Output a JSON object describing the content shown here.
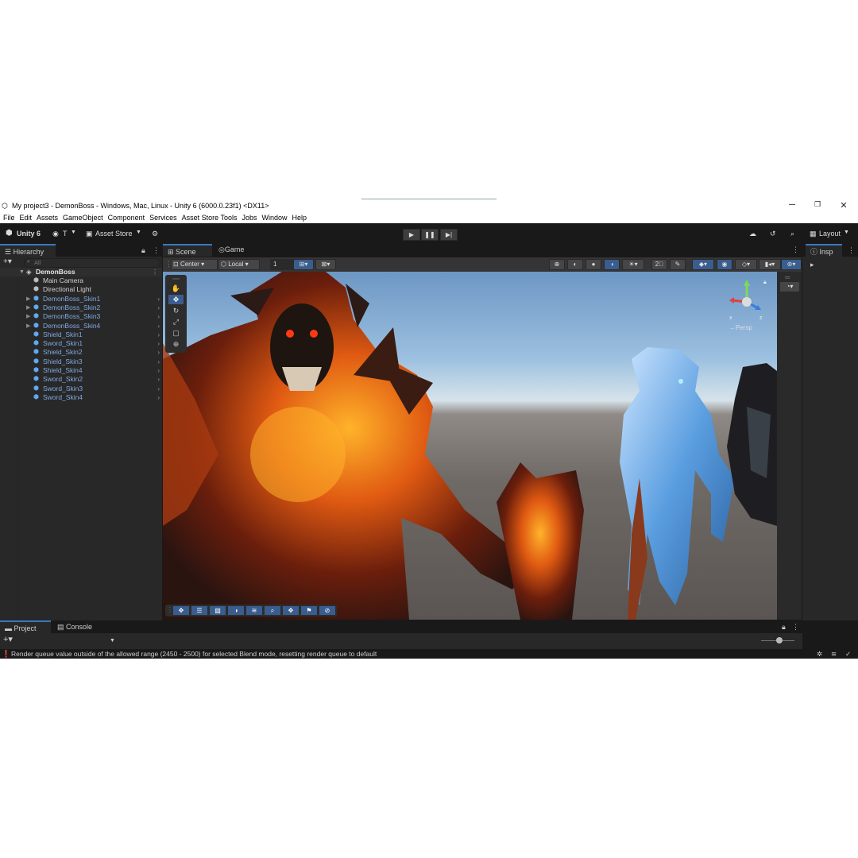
{
  "window": {
    "title": "My project3 - DemonBoss - Windows, Mac, Linux - Unity 6 (6000.0.23f1) <DX11>",
    "controls": [
      "─",
      "❐",
      "✕"
    ]
  },
  "menu": [
    "File",
    "Edit",
    "Assets",
    "GameObject",
    "Component",
    "Services",
    "Asset Store Tools",
    "Jobs",
    "Window",
    "Help"
  ],
  "toolbar": {
    "unity_label": "Unity 6",
    "account_label": "T",
    "asset_store_label": "Asset Store",
    "layout_label": "Layout"
  },
  "hierarchy": {
    "tab_label": "Hierarchy",
    "search_placeholder": "All",
    "root": "DemonBoss",
    "items": [
      {
        "label": "Main Camera",
        "prefab": false,
        "expandable": false
      },
      {
        "label": "Directional Light",
        "prefab": false,
        "expandable": false
      },
      {
        "label": "DemonBoss_Skin1",
        "prefab": true,
        "expandable": true
      },
      {
        "label": "DemonBoss_Skin2",
        "prefab": true,
        "expandable": true
      },
      {
        "label": "DemonBoss_Skin3",
        "prefab": true,
        "expandable": true
      },
      {
        "label": "DemonBoss_Skin4",
        "prefab": true,
        "expandable": true
      },
      {
        "label": "Shield_Skin1",
        "prefab": true,
        "expandable": false
      },
      {
        "label": "Sword_Skin1",
        "prefab": true,
        "expandable": false
      },
      {
        "label": "Shield_Skin2",
        "prefab": true,
        "expandable": false
      },
      {
        "label": "Shield_Skin3",
        "prefab": true,
        "expandable": false
      },
      {
        "label": "Shield_Skin4",
        "prefab": true,
        "expandable": false
      },
      {
        "label": "Sword_Skin2",
        "prefab": true,
        "expandable": false
      },
      {
        "label": "Sword_Skin3",
        "prefab": true,
        "expandable": false
      },
      {
        "label": "Sword_Skin4",
        "prefab": true,
        "expandable": false
      }
    ]
  },
  "scene": {
    "tabs": [
      "Scene",
      "Game"
    ],
    "pivot_label": "Center",
    "space_label": "Local",
    "grid_value": "1",
    "persp_label": "←Persp"
  },
  "inspector": {
    "tab_label": "Insp"
  },
  "bottom": {
    "tabs": [
      "Project",
      "Console"
    ],
    "status_message": "Render queue value outside of the allowed range (2450 - 2500) for selected Blend mode, resetting render queue to default"
  },
  "colors": {
    "accent": "#3a79bb",
    "prefab_text": "#7fa9e3",
    "panel": "#282828"
  }
}
